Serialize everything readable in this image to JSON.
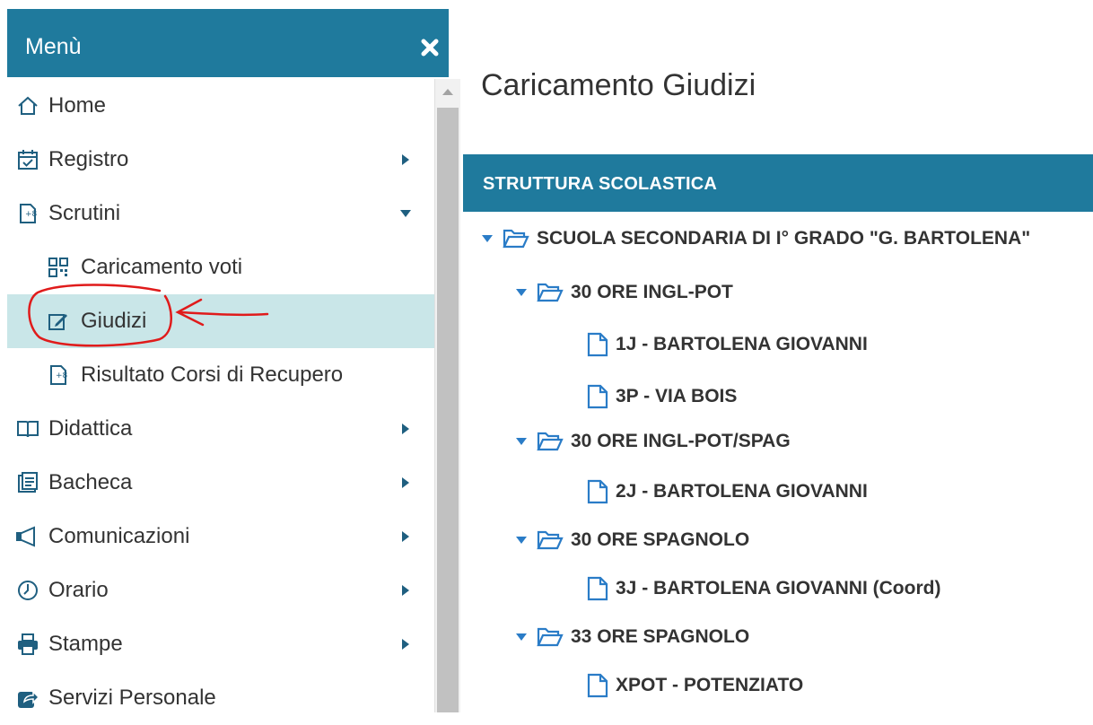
{
  "menu": {
    "title": "Menù",
    "items": [
      {
        "label": "Home"
      },
      {
        "label": "Registro"
      },
      {
        "label": "Scrutini"
      },
      {
        "label": "Caricamento voti"
      },
      {
        "label": "Giudizi"
      },
      {
        "label": "Risultato Corsi di Recupero"
      },
      {
        "label": "Didattica"
      },
      {
        "label": "Bacheca"
      },
      {
        "label": "Comunicazioni"
      },
      {
        "label": "Orario"
      },
      {
        "label": "Stampe"
      },
      {
        "label": "Servizi Personale"
      }
    ]
  },
  "page": {
    "title": "Caricamento Giudizi"
  },
  "structure": {
    "title": "STRUTTURA SCOLASTICA",
    "root": "SCUOLA SECONDARIA DI I° GRADO \"G. BARTOLENA\"",
    "groups": [
      {
        "label": "30 ORE INGL-POT",
        "classes": [
          "1J - BARTOLENA GIOVANNI",
          "3P - VIA BOIS"
        ]
      },
      {
        "label": "30 ORE INGL-POT/SPAG",
        "classes": [
          "2J - BARTOLENA GIOVANNI"
        ]
      },
      {
        "label": "30 ORE SPAGNOLO",
        "classes": [
          "3J - BARTOLENA GIOVANNI (Coord)"
        ]
      },
      {
        "label": "33 ORE SPAGNOLO",
        "classes": [
          "XPOT - POTENZIATO"
        ]
      }
    ]
  },
  "colors": {
    "header": "#1f7a9d",
    "active_item": "#c9e6e8",
    "annotation": "#e01b1b",
    "icon_blue": "#2a7cc7"
  }
}
